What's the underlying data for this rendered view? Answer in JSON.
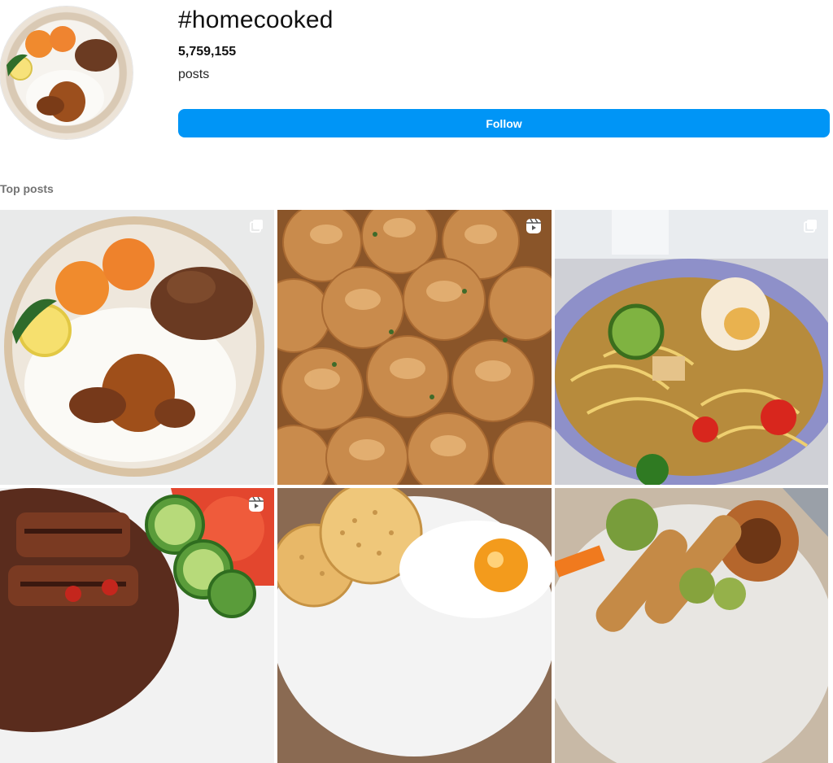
{
  "header": {
    "hashtag": "#homecooked",
    "post_count": "5,759,155",
    "post_count_label": "posts",
    "follow_label": "Follow",
    "follow_color": "#0095f6"
  },
  "sections": {
    "top_posts_label": "Top posts"
  },
  "posts": [
    {
      "subject": "plate of rice with chicken curry, sweet balls, lemon and fried meat",
      "badge_icon": "multiple-posts-icon"
    },
    {
      "subject": "golden pull-apart garlic bread rolls",
      "badge_icon": "reels-icon"
    },
    {
      "subject": "noodle curry laksa with boiled egg and lime",
      "badge_icon": "multiple-posts-icon"
    },
    {
      "subject": "grilled meat with cucumber and tomato slices",
      "badge_icon": "reels-icon"
    },
    {
      "subject": "crumpets with fried egg",
      "badge_icon": ""
    },
    {
      "subject": "roast dinner with yorkshire pudding",
      "badge_icon": ""
    }
  ],
  "colors": {
    "text_primary": "#111111",
    "text_secondary": "#737373"
  }
}
